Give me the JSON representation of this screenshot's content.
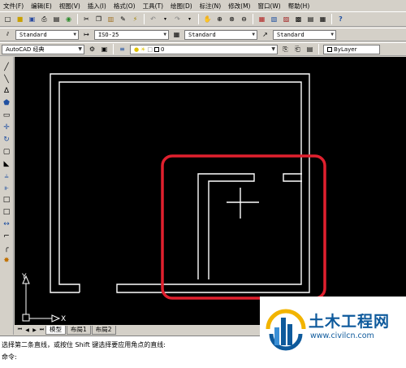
{
  "menubar": {
    "items": [
      "文件(F)",
      "编辑(E)",
      "视图(V)",
      "插入(I)",
      "格式(O)",
      "工具(T)",
      "绘图(D)",
      "标注(N)",
      "修改(M)",
      "窗口(W)",
      "帮助(H)"
    ]
  },
  "toolbar2": {
    "text_style": "Standard",
    "dim_style": "ISO-25",
    "table_style": "Standard",
    "multileader_style": "Standard"
  },
  "toolbar3": {
    "workspace": "AutoCAD 经典",
    "layer": "0",
    "color": "ByLayer"
  },
  "layout_tabs": [
    "模型",
    "布局1",
    "布局2"
  ],
  "ucs": {
    "x_label": "X",
    "y_label": "Y"
  },
  "command": {
    "prompt_line": "选择第二条直线，或按住 Shift 键选择要应用角点的直线:",
    "input_line": "命令:"
  },
  "watermark": {
    "title": "土木工程网",
    "url": "www.civilcn.com"
  },
  "colors": {
    "canvas_bg": "#000000",
    "highlight": "#e0202e",
    "watermark_brand": "#0e5a9c"
  }
}
